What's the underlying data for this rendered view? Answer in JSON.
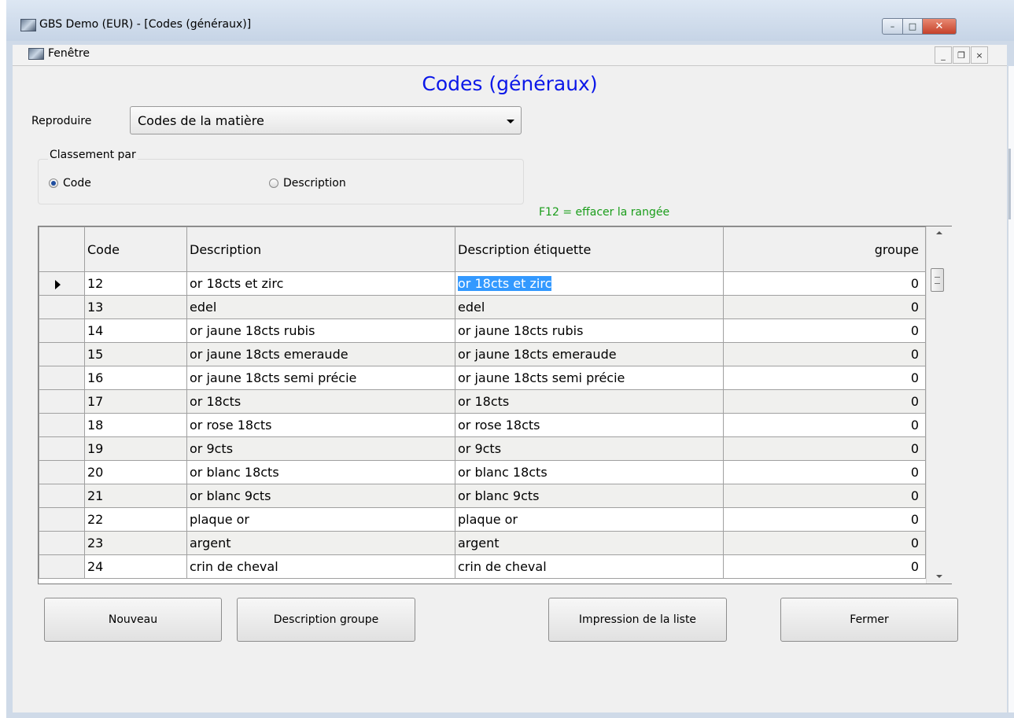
{
  "window": {
    "title": "GBS Demo (EUR) - [Codes (généraux)]",
    "caption_min": "–",
    "caption_max": "□",
    "caption_close": "✕"
  },
  "menu": {
    "items": [
      "Fenêtre"
    ],
    "mdi_min": "_",
    "mdi_restore": "❐",
    "mdi_close": "×"
  },
  "form": {
    "title": "Codes (généraux)",
    "reproduire_label": "Reproduire",
    "reproduire_value": "Codes de la matière",
    "classement_label": "Classement par",
    "classement_options": [
      {
        "label": "Code",
        "checked": true
      },
      {
        "label": "Description",
        "checked": false
      }
    ],
    "hint": "F12 = effacer la rangée"
  },
  "grid": {
    "columns": [
      "Code",
      "Description",
      "Description étiquette",
      "groupe"
    ],
    "selected_row": 0,
    "highlighted_cell_text": "or 18cts et zirc",
    "rows": [
      [
        "12",
        "or 18cts et zirc",
        "or 18cts et zirc",
        "0"
      ],
      [
        "13",
        "edel",
        "edel",
        "0"
      ],
      [
        "14",
        "or jaune 18cts rubis",
        "or jaune 18cts rubis",
        "0"
      ],
      [
        "15",
        "or jaune 18cts emeraude",
        "or jaune 18cts emeraude",
        "0"
      ],
      [
        "16",
        "or jaune 18cts semi précie",
        "or jaune 18cts semi précie",
        "0"
      ],
      [
        "17",
        "or 18cts",
        "or 18cts",
        "0"
      ],
      [
        "18",
        "or rose 18cts",
        "or rose 18cts",
        "0"
      ],
      [
        "19",
        "or 9cts",
        "or 9cts",
        "0"
      ],
      [
        "20",
        "or blanc 18cts",
        "or blanc 18cts",
        "0"
      ],
      [
        "21",
        "or blanc 9cts",
        "or blanc 9cts",
        "0"
      ],
      [
        "22",
        "plaque or",
        "plaque or",
        "0"
      ],
      [
        "23",
        "argent",
        "argent",
        "0"
      ],
      [
        "24",
        "crin de cheval",
        "crin de cheval",
        "0"
      ]
    ]
  },
  "buttons": {
    "nouveau": "Nouveau",
    "description_groupe": "Description groupe",
    "impression": "Impression de la liste",
    "fermer": "Fermer"
  },
  "colors": {
    "title_blue": "#0b17e8",
    "hint_green": "#1a9d1a",
    "highlight": "#3399ff"
  }
}
